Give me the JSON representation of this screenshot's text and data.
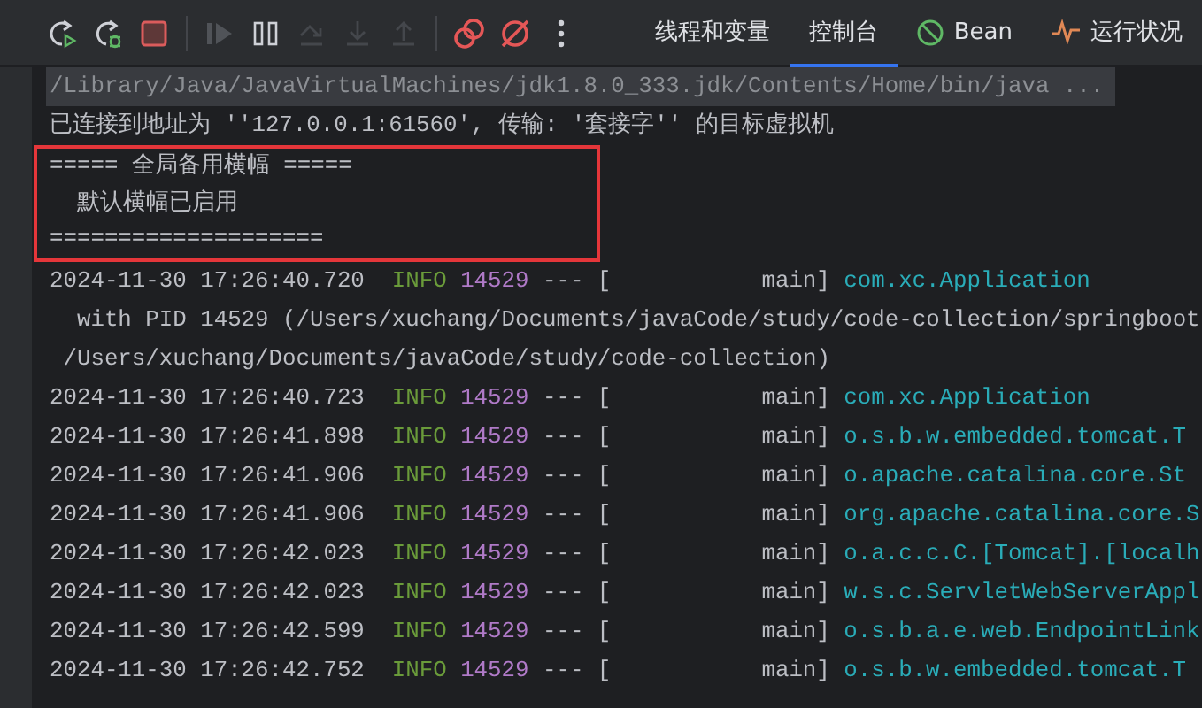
{
  "toolbar": {
    "buttons": [
      {
        "kind": "rerun",
        "disabled": false
      },
      {
        "kind": "rerun-debug",
        "disabled": false
      },
      {
        "kind": "stop",
        "disabled": false
      },
      {
        "kind": "resume",
        "disabled": true
      },
      {
        "kind": "pause",
        "disabled": false
      },
      {
        "kind": "step-over",
        "disabled": true
      },
      {
        "kind": "step-into",
        "disabled": true
      },
      {
        "kind": "step-out",
        "disabled": true
      },
      {
        "kind": "breakpoints",
        "disabled": false
      },
      {
        "kind": "mute",
        "disabled": false
      },
      {
        "kind": "more",
        "disabled": false
      }
    ],
    "tabs": [
      {
        "label": "线程和变量",
        "kind": "plain",
        "selected": false
      },
      {
        "label": "控制台",
        "kind": "plain",
        "selected": true
      },
      {
        "label": "Bean",
        "kind": "bean",
        "selected": false
      },
      {
        "label": "运行状况",
        "kind": "health",
        "selected": false
      }
    ]
  },
  "console": {
    "command": "/Library/Java/JavaVirtualMachines/jdk1.8.0_333.jdk/Contents/Home/bin/java ...",
    "lines": [
      {
        "kind": "text",
        "text": "已连接到地址为 ''127.0.0.1:61560', 传输: '套接字'' 的目标虚拟机"
      },
      {
        "kind": "banner",
        "lines": [
          "===== 全局备用横幅 =====",
          "  默认横幅已启用",
          "===================="
        ]
      },
      {
        "kind": "log",
        "timestamp": "2024-11-30 17:26:40.720",
        "level": "INFO",
        "pid": "14529",
        "dashes": "---",
        "bracket": "[",
        "thread": "main]",
        "logger": "com.xc.Application"
      },
      {
        "kind": "text",
        "text": "  with PID 14529 (/Users/xuchang/Documents/javaCode/study/code-collection/springboot"
      },
      {
        "kind": "text",
        "text": " /Users/xuchang/Documents/javaCode/study/code-collection)"
      },
      {
        "kind": "log",
        "timestamp": "2024-11-30 17:26:40.723",
        "level": "INFO",
        "pid": "14529",
        "dashes": "---",
        "bracket": "[",
        "thread": "main]",
        "logger": "com.xc.Application"
      },
      {
        "kind": "log",
        "timestamp": "2024-11-30 17:26:41.898",
        "level": "INFO",
        "pid": "14529",
        "dashes": "---",
        "bracket": "[",
        "thread": "main]",
        "logger": "o.s.b.w.embedded.tomcat.T"
      },
      {
        "kind": "log",
        "timestamp": "2024-11-30 17:26:41.906",
        "level": "INFO",
        "pid": "14529",
        "dashes": "---",
        "bracket": "[",
        "thread": "main]",
        "logger": "o.apache.catalina.core.St"
      },
      {
        "kind": "log",
        "timestamp": "2024-11-30 17:26:41.906",
        "level": "INFO",
        "pid": "14529",
        "dashes": "---",
        "bracket": "[",
        "thread": "main]",
        "logger": "org.apache.catalina.core.S"
      },
      {
        "kind": "log",
        "timestamp": "2024-11-30 17:26:42.023",
        "level": "INFO",
        "pid": "14529",
        "dashes": "---",
        "bracket": "[",
        "thread": "main]",
        "logger": "o.a.c.c.C.[Tomcat].[localh"
      },
      {
        "kind": "log",
        "timestamp": "2024-11-30 17:26:42.023",
        "level": "INFO",
        "pid": "14529",
        "dashes": "---",
        "bracket": "[",
        "thread": "main]",
        "logger": "w.s.c.ServletWebServerAppl"
      },
      {
        "kind": "log",
        "timestamp": "2024-11-30 17:26:42.599",
        "level": "INFO",
        "pid": "14529",
        "dashes": "---",
        "bracket": "[",
        "thread": "main]",
        "logger": "o.s.b.a.e.web.EndpointLink"
      },
      {
        "kind": "log",
        "timestamp": "2024-11-30 17:26:42.752",
        "level": "INFO",
        "pid": "14529",
        "dashes": "---",
        "bracket": "[",
        "thread": "main]",
        "logger": "o.s.b.w.embedded.tomcat.T"
      }
    ]
  }
}
